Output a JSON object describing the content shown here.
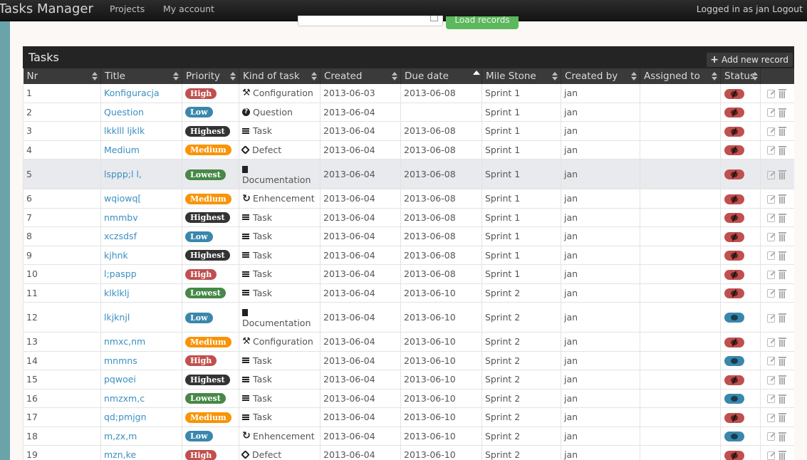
{
  "app": {
    "brand": "Tasks Manager",
    "nav": [
      "Projects",
      "My account"
    ],
    "user_text": "Logged in as jan",
    "logout": "Logout"
  },
  "toolbar": {
    "load_label": "Load records"
  },
  "table": {
    "title": "Tasks",
    "add_label": "Add new record",
    "columns": [
      "Nr",
      "Title",
      "Priority",
      "Kind of task",
      "Created",
      "Due date",
      "Mile Stone",
      "Created by",
      "Assigned to",
      "Status"
    ],
    "rows": [
      {
        "nr": "1",
        "title": "Konfiguracja",
        "priority": "High",
        "kind": "Configuration",
        "created": "2013-06-03",
        "due": "2013-06-08",
        "milestone": "Sprint 1",
        "created_by": "jan",
        "assigned": "",
        "status": "closed"
      },
      {
        "nr": "2",
        "title": "Question",
        "priority": "Low",
        "kind": "Question",
        "created": "2013-06-04",
        "due": "",
        "milestone": "Sprint 1",
        "created_by": "jan",
        "assigned": "",
        "status": "closed"
      },
      {
        "nr": "3",
        "title": "lkklll ljklk",
        "priority": "Highest",
        "kind": "Task",
        "created": "2013-06-04",
        "due": "2013-06-08",
        "milestone": "Sprint 1",
        "created_by": "jan",
        "assigned": "",
        "status": "closed"
      },
      {
        "nr": "4",
        "title": "Medium",
        "priority": "Medium",
        "kind": "Defect",
        "created": "2013-06-04",
        "due": "2013-06-08",
        "milestone": "Sprint 1",
        "created_by": "jan",
        "assigned": "",
        "status": "closed"
      },
      {
        "nr": "5",
        "title": "lsppp;l l,",
        "priority": "Lowest",
        "kind": "Documentation",
        "created": "2013-06-04",
        "due": "2013-06-08",
        "milestone": "Sprint 1",
        "created_by": "jan",
        "assigned": "",
        "status": "closed"
      },
      {
        "nr": "6",
        "title": "wqiowq[",
        "priority": "Medium",
        "kind": "Enhencement",
        "created": "2013-06-04",
        "due": "2013-06-08",
        "milestone": "Sprint 1",
        "created_by": "jan",
        "assigned": "",
        "status": "closed"
      },
      {
        "nr": "7",
        "title": "nmmbv",
        "priority": "Highest",
        "kind": "Task",
        "created": "2013-06-04",
        "due": "2013-06-08",
        "milestone": "Sprint 1",
        "created_by": "jan",
        "assigned": "",
        "status": "closed"
      },
      {
        "nr": "8",
        "title": "xczsdsf",
        "priority": "Low",
        "kind": "Task",
        "created": "2013-06-04",
        "due": "2013-06-08",
        "milestone": "Sprint 1",
        "created_by": "jan",
        "assigned": "",
        "status": "closed"
      },
      {
        "nr": "9",
        "title": "kjhnk",
        "priority": "Highest",
        "kind": "Task",
        "created": "2013-06-04",
        "due": "2013-06-08",
        "milestone": "Sprint 1",
        "created_by": "jan",
        "assigned": "",
        "status": "closed"
      },
      {
        "nr": "10",
        "title": "l;paspp",
        "priority": "High",
        "kind": "Task",
        "created": "2013-06-04",
        "due": "2013-06-08",
        "milestone": "Sprint 1",
        "created_by": "jan",
        "assigned": "",
        "status": "closed"
      },
      {
        "nr": "11",
        "title": "klklklj",
        "priority": "Lowest",
        "kind": "Task",
        "created": "2013-06-04",
        "due": "2013-06-10",
        "milestone": "Sprint 2",
        "created_by": "jan",
        "assigned": "",
        "status": "closed"
      },
      {
        "nr": "12",
        "title": "lkjknjl",
        "priority": "Low",
        "kind": "Documentation",
        "created": "2013-06-04",
        "due": "2013-06-10",
        "milestone": "Sprint 2",
        "created_by": "jan",
        "assigned": "",
        "status": "open"
      },
      {
        "nr": "13",
        "title": "nmxc,nm",
        "priority": "Medium",
        "kind": "Configuration",
        "created": "2013-06-04",
        "due": "2013-06-10",
        "milestone": "Sprint 2",
        "created_by": "jan",
        "assigned": "",
        "status": "closed"
      },
      {
        "nr": "14",
        "title": "mnmns",
        "priority": "High",
        "kind": "Task",
        "created": "2013-06-04",
        "due": "2013-06-10",
        "milestone": "Sprint 2",
        "created_by": "jan",
        "assigned": "",
        "status": "open"
      },
      {
        "nr": "15",
        "title": "pqwoei",
        "priority": "Highest",
        "kind": "Task",
        "created": "2013-06-04",
        "due": "2013-06-10",
        "milestone": "Sprint 2",
        "created_by": "jan",
        "assigned": "",
        "status": "closed"
      },
      {
        "nr": "16",
        "title": "nmzxm,c",
        "priority": "Lowest",
        "kind": "Task",
        "created": "2013-06-04",
        "due": "2013-06-10",
        "milestone": "Sprint 2",
        "created_by": "jan",
        "assigned": "",
        "status": "open"
      },
      {
        "nr": "17",
        "title": "qd;pmjgn",
        "priority": "Medium",
        "kind": "Task",
        "created": "2013-06-04",
        "due": "2013-06-10",
        "milestone": "Sprint 2",
        "created_by": "jan",
        "assigned": "",
        "status": "closed"
      },
      {
        "nr": "18",
        "title": "m,zx,m",
        "priority": "Low",
        "kind": "Enhencement",
        "created": "2013-06-04",
        "due": "2013-06-10",
        "milestone": "Sprint 2",
        "created_by": "jan",
        "assigned": "",
        "status": "open"
      },
      {
        "nr": "19",
        "title": "mzn,ke",
        "priority": "High",
        "kind": "Defect",
        "created": "2013-06-04",
        "due": "2013-06-10",
        "milestone": "Sprint 2",
        "created_by": "jan",
        "assigned": "",
        "status": "closed"
      }
    ]
  },
  "colors": {
    "priority": {
      "High": "#c0504e",
      "Low": "#3a87ad",
      "Highest": "#333333",
      "Medium": "#f89406",
      "Lowest": "#468847"
    },
    "status": {
      "closed": "#c0504e",
      "open": "#3a87ad"
    },
    "accent_sidebar": "#6aa4a9"
  },
  "kind_icons": {
    "Configuration": "wrench-icon",
    "Question": "question-icon",
    "Task": "list-icon",
    "Defect": "bug-icon",
    "Documentation": "book-icon",
    "Enhencement": "refresh-icon"
  }
}
